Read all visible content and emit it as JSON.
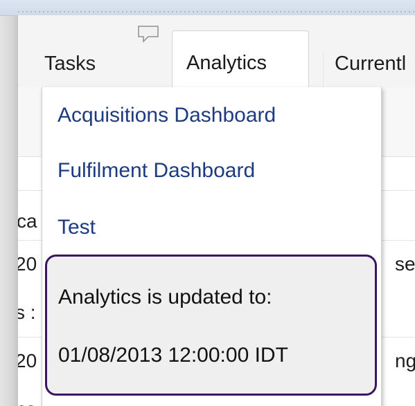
{
  "tabs": {
    "tasks": "Tasks",
    "analytics": "Analytics",
    "current": "Currentl"
  },
  "background_grid": {
    "column_header_fragment": "ca",
    "row1_left": "20",
    "row1_right": "se",
    "row2_left": "s :",
    "row3_left": "20",
    "row3_right": "ng",
    "row4_left": "ns"
  },
  "dropdown": {
    "items": [
      {
        "label": "Acquisitions Dashboard"
      },
      {
        "label": "Fulfilment Dashboard"
      },
      {
        "label": "Test"
      }
    ],
    "info": {
      "label": "Analytics is updated to:",
      "value": "01/08/2013 12:00:00 IDT"
    }
  },
  "colors": {
    "menu_link": "#1d3b80",
    "info_border": "#3a1560",
    "info_background": "#efefef"
  }
}
